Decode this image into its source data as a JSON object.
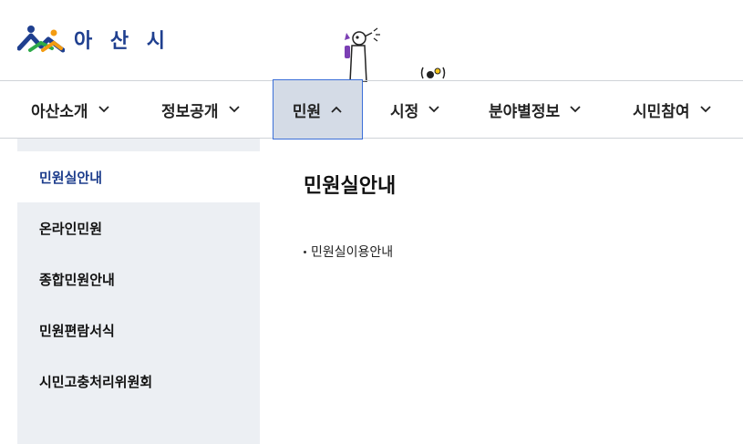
{
  "header": {
    "logo_text": "아 산 시",
    "logo_colors": {
      "blue": "#1f3f8f",
      "orange": "#f39c12",
      "green": "#2eaa4a"
    },
    "mascot_icon": "mascot-icon"
  },
  "gnb": {
    "items": [
      {
        "label": "아산소개",
        "chevron": "chevron-down-icon"
      },
      {
        "label": "정보공개",
        "chevron": "chevron-down-icon"
      },
      {
        "label": "민원",
        "chevron": "chevron-up-icon",
        "active": true
      },
      {
        "label": "시정",
        "chevron": "chevron-down-icon"
      },
      {
        "label": "분야별정보",
        "chevron": "chevron-down-icon"
      },
      {
        "label": "시민참여",
        "chevron": "chevron-down-icon"
      }
    ],
    "active_bg": "#d4dbe6",
    "active_border": "#3b6fd8"
  },
  "lnb": {
    "items": [
      {
        "label": "민원실안내",
        "active": true
      },
      {
        "label": "온라인민원"
      },
      {
        "label": "종합민원안내"
      },
      {
        "label": "민원편람서식"
      },
      {
        "label": "시민고충처리위원회"
      }
    ],
    "bg": "#eceff3",
    "active_color": "#1d3d8c"
  },
  "content": {
    "title": "민원실안내",
    "links": [
      {
        "label": "민원실이용안내"
      }
    ]
  }
}
